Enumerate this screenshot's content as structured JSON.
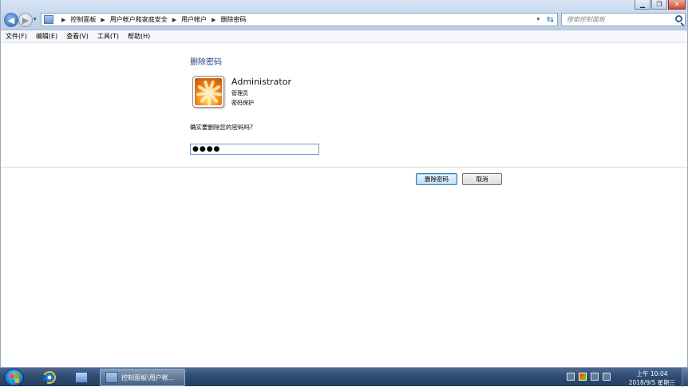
{
  "window": {
    "controls": {
      "minimize": "▁",
      "restore": "❐",
      "close": "✕"
    }
  },
  "address_bar": {
    "breadcrumb": [
      "控制面板",
      "用户帐户和家庭安全",
      "用户帐户",
      "删除密码"
    ]
  },
  "search": {
    "placeholder": "搜索控制面板"
  },
  "menu": {
    "items": [
      "文件(F)",
      "编辑(E)",
      "查看(V)",
      "工具(T)",
      "帮助(H)"
    ]
  },
  "content": {
    "heading": "删除密码",
    "user": {
      "name": "Administrator",
      "type": "管理员",
      "protection": "密码保护"
    },
    "question": "确实要删除您的密码吗?",
    "password_value": "●●●●",
    "primary_button": "删除密码",
    "cancel_button": "取消"
  },
  "taskbar": {
    "active_task_label": "控制面板\\用户帐...",
    "clock_time": "上午 10:04",
    "clock_date": "2018/9/5 星期三"
  }
}
